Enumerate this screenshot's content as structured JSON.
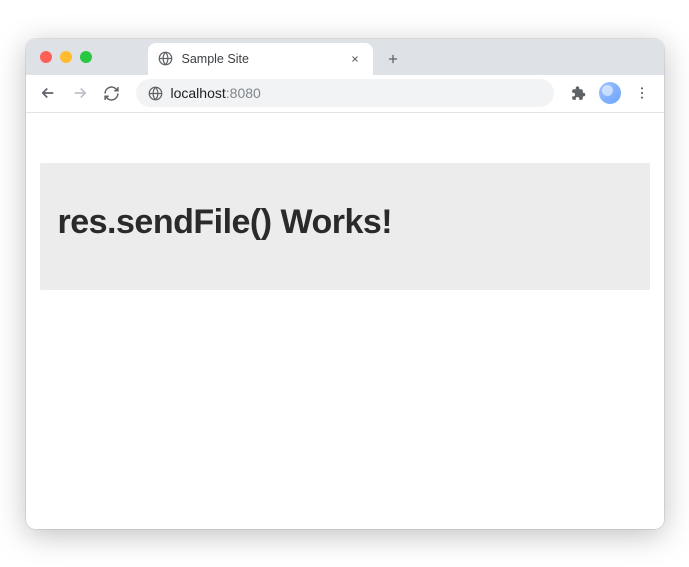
{
  "window": {
    "traffic_lights": {
      "red": "#ff5f57",
      "yellow": "#febc2e",
      "green": "#28c840"
    }
  },
  "tab": {
    "title": "Sample Site"
  },
  "address_bar": {
    "host": "localhost",
    "port": ":8080"
  },
  "page": {
    "heading": "res.sendFile() Works!"
  }
}
